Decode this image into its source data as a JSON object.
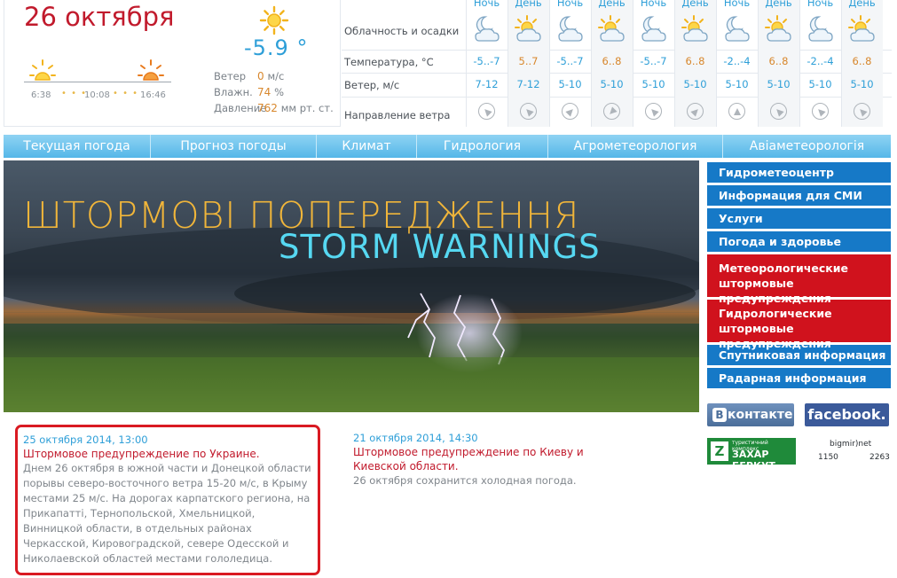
{
  "header": {
    "date": "26 октября",
    "current_temp": "-5.9 °",
    "sunrise": "6:38",
    "midday": "10:08",
    "sunset": "16:46",
    "conditions": [
      {
        "label": "Ветер",
        "value": "0",
        "unit": "м/с"
      },
      {
        "label": "Влажн.",
        "value": "74",
        "unit": "%"
      },
      {
        "label": "Давление",
        "value": "762",
        "unit": "мм рт. ст."
      }
    ]
  },
  "forecast": {
    "row_labels": [
      "Облачность и осадки",
      "Температура, °С",
      "Ветер, м/с",
      "Направление ветра"
    ],
    "columns": [
      {
        "period": "Ночь",
        "icon": "moon-cloud-icon",
        "temp": "-5..-7",
        "wind": "7-12",
        "direction": "north-west"
      },
      {
        "period": "День",
        "icon": "sun-cloud-icon",
        "temp": "5..7",
        "wind": "7-12",
        "direction": "north-west"
      },
      {
        "period": "Ночь",
        "icon": "moon-cloud-icon",
        "temp": "-5..-7",
        "wind": "5-10",
        "direction": "north-east"
      },
      {
        "period": "День",
        "icon": "sun-cloud-icon",
        "temp": "6..8",
        "wind": "5-10",
        "direction": "south-west"
      },
      {
        "period": "Ночь",
        "icon": "moon-cloud-icon",
        "temp": "-5..-7",
        "wind": "5-10",
        "direction": "north-west"
      },
      {
        "period": "День",
        "icon": "sun-cloud-icon",
        "temp": "6..8",
        "wind": "5-10",
        "direction": "north-east"
      },
      {
        "period": "Ночь",
        "icon": "moon-cloud-icon",
        "temp": "-2..-4",
        "wind": "5-10",
        "direction": "north"
      },
      {
        "period": "День",
        "icon": "sun-cloud-icon",
        "temp": "6..8",
        "wind": "5-10",
        "direction": "north-west"
      },
      {
        "period": "Ночь",
        "icon": "moon-cloud-icon",
        "temp": "-2..-4",
        "wind": "5-10",
        "direction": "north-west"
      },
      {
        "period": "День",
        "icon": "sun-cloud-icon",
        "temp": "6..8",
        "wind": "5-10",
        "direction": "north-west"
      }
    ]
  },
  "nav": [
    "Текущая погода",
    "Прогноз погоды",
    "Климат",
    "Гидрология",
    "Агрометеорология",
    "Авіаметеорологія"
  ],
  "banner": {
    "title_ua": "ШТОРМОВІ ПОПЕРЕДЖЕННЯ",
    "title_en": "STORM WARNINGS"
  },
  "sidebar": [
    {
      "label": "Гидрометеоцентр",
      "style": "blue"
    },
    {
      "label": "Информация для СМИ",
      "style": "blue"
    },
    {
      "label": "Услуги",
      "style": "blue"
    },
    {
      "label": "Погода и здоровье",
      "style": "blue"
    },
    {
      "label": "Метеорологические штормовые предупреждения",
      "style": "red"
    },
    {
      "label": "Гидрологические штормовые предупреждения",
      "style": "red"
    },
    {
      "label": "Спутниковая информация",
      "style": "blue"
    },
    {
      "label": "Радарная информация",
      "style": "blue"
    }
  ],
  "social": {
    "vk": "контакте",
    "vk_mark": "В",
    "facebook": "facebook."
  },
  "partners": {
    "zb_sub": "туристичний комплекс",
    "zb_name": "ЗАХАР БЕРКУТ",
    "bigmir_name": "bigmir)net",
    "bigmir_a": "1150",
    "bigmir_b": "2263"
  },
  "news": [
    {
      "date": "25 октября 2014, 13:00",
      "title": "Штормовое предупреждение по Украине.",
      "body": "Днем 26 октября в южной части и Донецкой области порывы северо-восточного ветра 15-20 м/с, в Крыму местами 25 м/с. На дорогах карпатского региона, на Прикапатті, Тернопольской, Хмельницкой, Винницкой области, в отдельных районах Черкасской, Кировоградской, севере Одесской и Николаевской областей местами гололедица."
    },
    {
      "date": "21 октября 2014, 14:30",
      "title": "Штормовое предупреждение по Киеву и Киевской области.",
      "body": "26 октября сохранится холодная погода."
    }
  ],
  "colors": {
    "accent": "#2e9fd8",
    "brand_red": "#c11a2c",
    "sidebar_blue": "#1679c7",
    "sidebar_red": "#d0121d"
  }
}
